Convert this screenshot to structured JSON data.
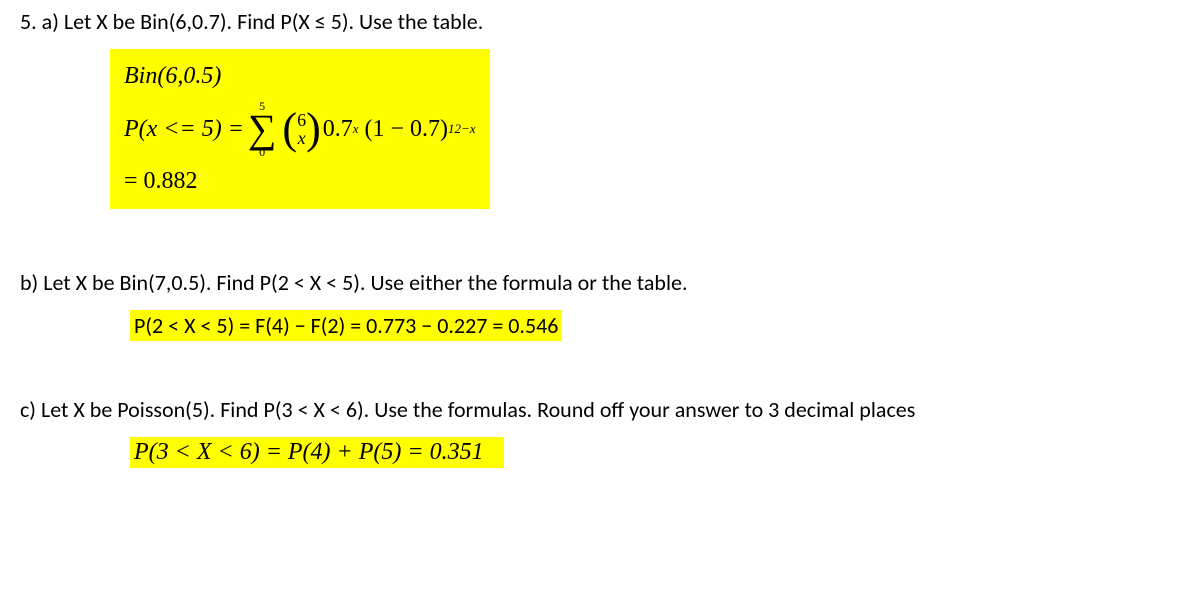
{
  "a": {
    "question": "5. a) Let X be Bin(6,0.7). Find P(X ≤ 5). Use the table.",
    "distLabel": "Bin(6,0.5)",
    "lhs": "P(x <= 5) = ",
    "sumTop": "5",
    "sumBot": "0",
    "binomTop": "6",
    "binomBot": "x",
    "termBase1": "0.7",
    "termExp1": "x",
    "termMid": "(1 − 0.7)",
    "termExp2": "12−x",
    "result": "= 0.882"
  },
  "b": {
    "question": "b) Let X be Bin(7,0.5). Find P(2 < X < 5). Use either the formula or the table.",
    "answer": "P(2 < X < 5) = F(4) − F(2) = 0.773 − 0.227 = 0.546"
  },
  "c": {
    "question": "c) Let X be Poisson(5). Find P(3 < X < 6). Use the formulas. Round off your answer to 3 decimal places",
    "answer": "P(3 < X < 6) = P(4) + P(5) = 0.351"
  }
}
